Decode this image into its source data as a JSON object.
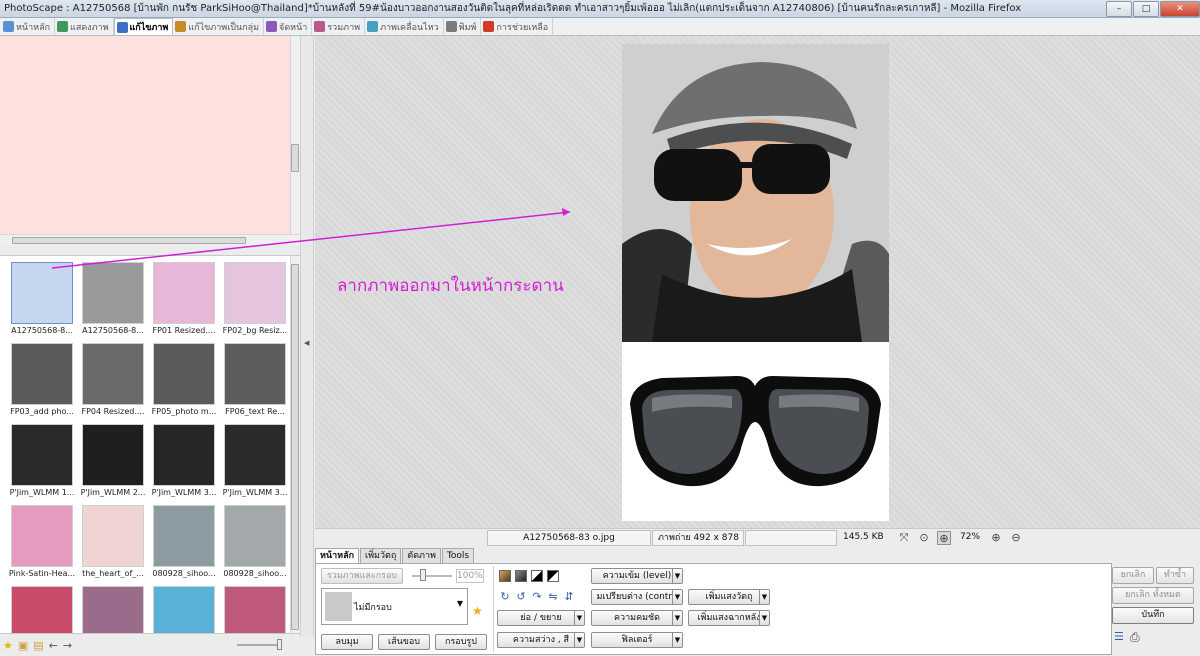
{
  "window": {
    "title": "PhotoScape : A12750568 [บ้านพัก กนรัช ParkSiHoo@Thailand]*บ้านหลังที่ 59#น้องบาวออกงานสองวันติดในลุคที่หล่อเริดดด ทำเอาสาวๆยิ้มเพ้อออ ไม่เลิก(แตกประเด็นจาก A12740806) [บ้านคนรักละครเกาหลี] - Mozilla Firefox",
    "controls": {
      "minimize": "–",
      "maximize": "□",
      "close": "✕"
    }
  },
  "tabs": [
    {
      "label": "หน้าหลัก",
      "color": "#5b8fd6"
    },
    {
      "label": "แสดงภาพ",
      "color": "#3f9a5a"
    },
    {
      "label": "แก้ไขภาพ",
      "color": "#3c6fc4",
      "active": true
    },
    {
      "label": "แก้ไขภาพเป็นกลุ่ม",
      "color": "#c58b2a"
    },
    {
      "label": "จัดหน้า",
      "color": "#8a5ab8"
    },
    {
      "label": "รวมภาพ",
      "color": "#b85a8a"
    },
    {
      "label": "ภาพเคลื่อนไหว",
      "color": "#4a9fc0"
    },
    {
      "label": "พิมพ์",
      "color": "#7a7a7a"
    },
    {
      "label": "การช่วยเหลือ",
      "color": "#d23a2a"
    }
  ],
  "thumbnails": [
    {
      "label": "A12750568-8...",
      "selected": true,
      "bg": "#c7d6ef"
    },
    {
      "label": "A12750568-8...",
      "bg": "#9a9a9a"
    },
    {
      "label": "FP01 Resized....",
      "bg": "#e8b7d8"
    },
    {
      "label": "FP02_bg Resiz...",
      "bg": "#e5c4de"
    },
    {
      "label": "FP03_add pho...",
      "bg": "#5a5a5a"
    },
    {
      "label": "FP04 Resized....",
      "bg": "#6a6a6a"
    },
    {
      "label": "FP05_photo m...",
      "bg": "#5b5b5b"
    },
    {
      "label": "FP06_text Re...",
      "bg": "#5d5d5d"
    },
    {
      "label": "P'Jim_WLMM 1...",
      "bg": "#2a2a2a"
    },
    {
      "label": "P'Jim_WLMM 2...",
      "bg": "#1f1f1f"
    },
    {
      "label": "P'Jim_WLMM 3...",
      "bg": "#262626"
    },
    {
      "label": "P'Jim_WLMM 3...",
      "bg": "#2b2b2b"
    },
    {
      "label": "Pink-Satin-Hea...",
      "bg": "#e59bbf"
    },
    {
      "label": "the_heart_of_...",
      "bg": "#f0d4d4"
    },
    {
      "label": "080928_sihoo...",
      "bg": "#8b9aa3"
    },
    {
      "label": "080928_sihoo...",
      "bg": "#a3a8ab"
    },
    {
      "label": "",
      "bg": "#c94c6a"
    },
    {
      "label": "",
      "bg": "#9a6b8a"
    },
    {
      "label": "",
      "bg": "#5bb0d8"
    },
    {
      "label": "",
      "bg": "#c05a7a"
    }
  ],
  "canvas": {
    "annotation": "ลากภาพออกมาในหน้ากระดาน"
  },
  "status": {
    "filename": "A12750568-83 o.jpg",
    "dimensions": "ภาพถ่าย 492 x 878",
    "filesize": "145.5 KB",
    "zoom": "72%"
  },
  "edit": {
    "subtabs": [
      "หน้าหลัก",
      "เพิ่มวัตถุ",
      "ตัดภาพ",
      "Tools"
    ],
    "merge_frame": "รวมภาพและกรอบ",
    "percent": "100%",
    "frame_name": "ไม่มีกรอบ",
    "round_button": "ลบมุม",
    "border_button": "เส้นขอบ",
    "frame_button": "กรอบรูป",
    "resize_button": "ย่อ / ขยาย",
    "brightness_button": "ความสว่าง , สี",
    "level_button": "ความเข้ม (level)",
    "contrast_button": "มเปรียบต่าง (contra",
    "sharpen_button": "ความคมชัด",
    "filter_button": "ฟิลเตอร์",
    "backlight_button": "เพิ่มแสงวัตถุ",
    "backlight2_button": "เพิ่มแสงฉากหลัง"
  },
  "right": {
    "undo": "ยกเลิก",
    "redo": "ทำซ้ำ",
    "undo_all": "ยกเลิก ทั้งหมด",
    "save": "บันทึก"
  },
  "icons": {
    "star": "★",
    "dropdown": "▼",
    "back": "◀",
    "forward": "▶",
    "zoom_in": "⊕",
    "zoom_out": "⊖",
    "fit": "⤢",
    "print": "⎙"
  }
}
